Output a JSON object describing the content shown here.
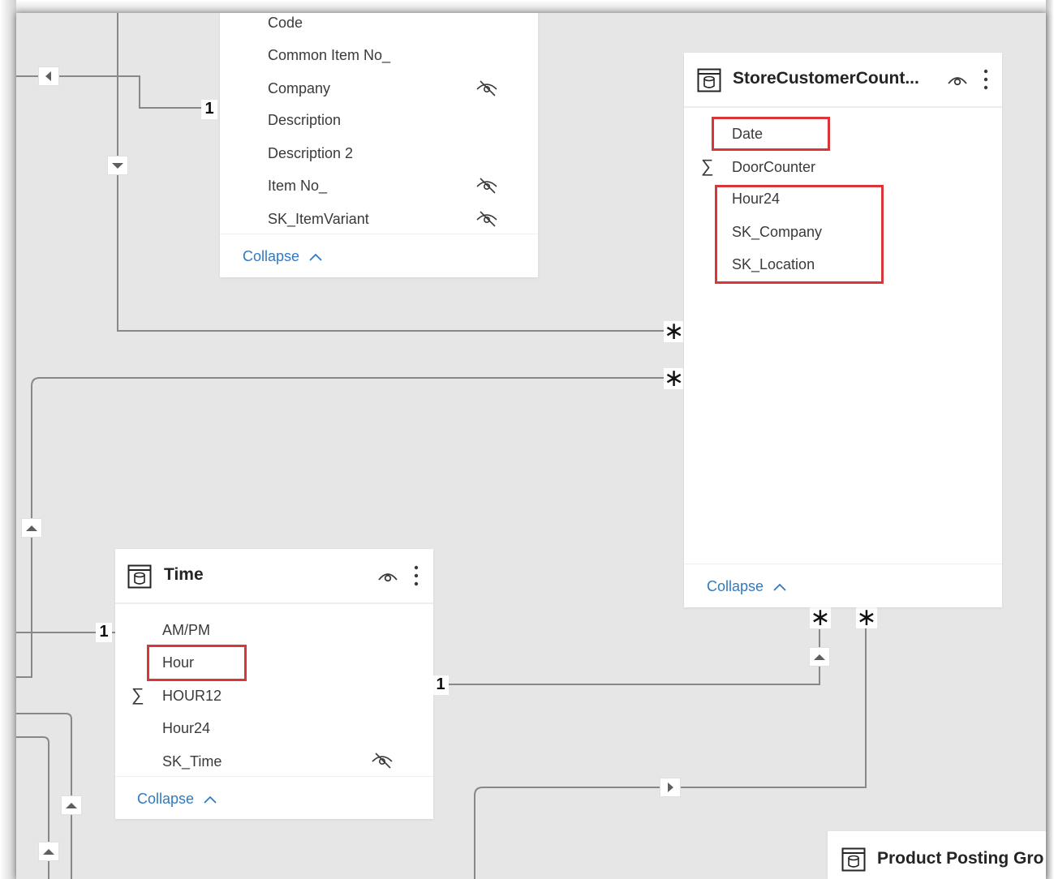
{
  "tables": {
    "item": {
      "fields": [
        {
          "label": "Code",
          "hidden": false
        },
        {
          "label": "Common Item No_",
          "hidden": false
        },
        {
          "label": "Company",
          "hidden": true
        },
        {
          "label": "Description",
          "hidden": false
        },
        {
          "label": "Description 2",
          "hidden": false
        },
        {
          "label": "Item No_",
          "hidden": true
        },
        {
          "label": "SK_ItemVariant",
          "hidden": true
        }
      ],
      "collapse_label": "Collapse"
    },
    "store_customer_count": {
      "title": "StoreCustomerCount...",
      "fields": [
        {
          "label": "Date",
          "measure": false,
          "highlighted": true
        },
        {
          "label": "DoorCounter",
          "measure": true,
          "highlighted": false
        },
        {
          "label": "Hour24",
          "measure": false,
          "highlighted": true
        },
        {
          "label": "SK_Company",
          "measure": false,
          "highlighted": true
        },
        {
          "label": "SK_Location",
          "measure": false,
          "highlighted": true
        }
      ],
      "collapse_label": "Collapse"
    },
    "time": {
      "title": "Time",
      "fields": [
        {
          "label": "AM/PM",
          "measure": false,
          "hidden": false,
          "highlighted": false
        },
        {
          "label": "Hour",
          "measure": false,
          "hidden": false,
          "highlighted": true
        },
        {
          "label": "HOUR12",
          "measure": true,
          "hidden": false,
          "highlighted": false
        },
        {
          "label": "Hour24",
          "measure": false,
          "hidden": false,
          "highlighted": false
        },
        {
          "label": "SK_Time",
          "measure": false,
          "hidden": true,
          "highlighted": false
        }
      ],
      "collapse_label": "Collapse"
    },
    "product_posting": {
      "title": "Product Posting Gro"
    }
  },
  "relationships": {
    "one": "1",
    "many": "∗"
  },
  "icons": {
    "table": "table-icon",
    "visibility": "eye-icon",
    "more": "more-options-icon",
    "hidden": "eye-hidden-icon",
    "measure": "sigma-icon",
    "scroll_arrows": [
      "caret-left-icon",
      "caret-down-icon",
      "caret-up-icon",
      "caret-right-icon"
    ]
  },
  "colors": {
    "canvas": "#e6e6e6",
    "card": "#ffffff",
    "highlight": "#d9363a",
    "link": "#2f7ac4",
    "connector": "#8a8886",
    "text": "#3b3a39"
  }
}
